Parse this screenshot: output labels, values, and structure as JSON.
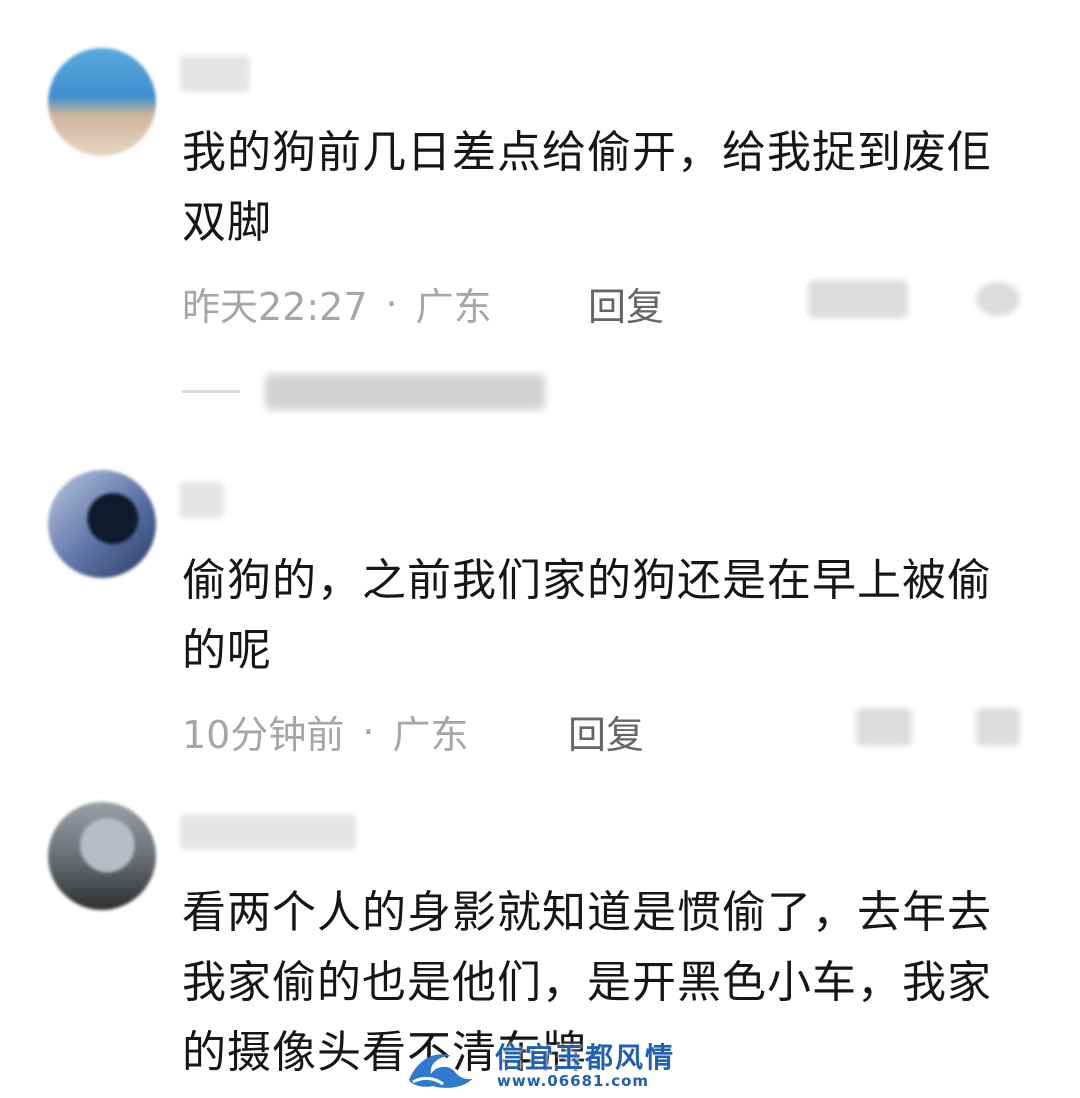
{
  "comments": [
    {
      "text": "我的狗前几日差点给偷开，给我捉到废佢双脚",
      "time": "昨天22:27",
      "location": "广东",
      "reply_label": "回复"
    },
    {
      "text": "偷狗的，之前我们家的狗还是在早上被偷的呢",
      "time": "10分钟前",
      "location": "广东",
      "reply_label": "回复"
    },
    {
      "text": "看两个人的身影就知道是惯偷了，去年去我家偷的也是他们，是开黑色小车，我家的摄像头看不清车牌"
    }
  ],
  "separator": "·",
  "watermark": {
    "title": "信宜玉都风情",
    "url": "www.06681.com"
  },
  "colors": {
    "text": "#161616",
    "meta": "#a6a6a6",
    "reply": "#666666",
    "watermark": "#1e60b4"
  }
}
